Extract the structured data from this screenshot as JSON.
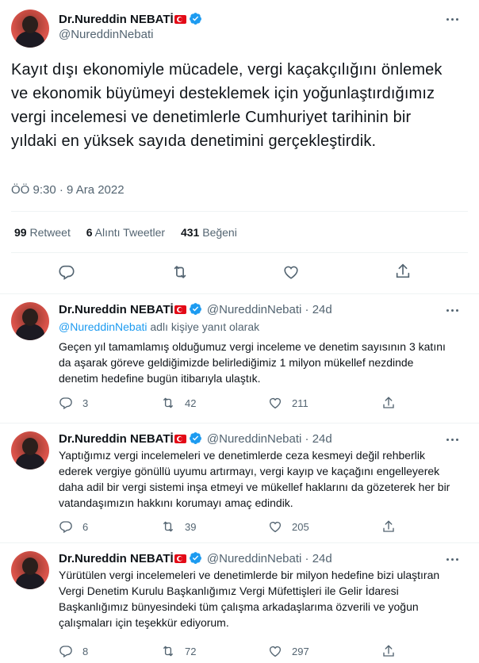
{
  "main": {
    "name": "Dr.Nureddin NEBATİ",
    "handle": "@NureddinNebati",
    "text": "Kayıt dışı ekonomiyle mücadele, vergi kaçakçılığını önlemek ve ekonomik büyümeyi desteklemek için yoğunlaştırdığımız vergi incelemesi ve denetimlerle Cumhuriyet tarihinin bir yıldaki en yüksek sayıda denetimini gerçekleştirdik.",
    "timestamp": "ÖÖ 9:30 · 9 Ara 2022",
    "retweets_count": "99",
    "retweets_label": "Retweet",
    "quotes_count": "6",
    "quotes_label": "Alıntı Tweetler",
    "likes_count": "431",
    "likes_label": "Beğeni"
  },
  "replies": [
    {
      "name": "Dr.Nureddin NEBATİ",
      "handle": "@NureddinNebati · 24d",
      "reply_to_mention": "@NureddinNebati",
      "reply_to_suffix": " adlı kişiye yanıt olarak",
      "text": "Geçen yıl tamamlamış olduğumuz vergi inceleme ve denetim sayısının 3 katını da aşarak göreve geldiğimizde belirlediğimiz 1 milyon mükellef nezdinde denetim hedefine bugün itibarıyla ulaştık.",
      "reply_count": "3",
      "retweet_count": "42",
      "like_count": "211"
    },
    {
      "name": "Dr.Nureddin NEBATİ",
      "handle": "@NureddinNebati · 24d",
      "text": "Yaptığımız vergi incelemeleri ve denetimlerde ceza kesmeyi değil rehberlik ederek vergiye gönüllü uyumu artırmayı, vergi kayıp ve kaçağını engelleyerek daha adil bir vergi sistemi inşa etmeyi ve mükellef haklarını da gözeterek her bir vatandaşımızın hakkını korumayı amaç edindik.",
      "reply_count": "6",
      "retweet_count": "39",
      "like_count": "205"
    },
    {
      "name": "Dr.Nureddin NEBATİ",
      "handle": "@NureddinNebati · 24d",
      "text": "Yürütülen vergi incelemeleri ve denetimlerde bir milyon hedefine bizi ulaştıran Vergi Denetim Kurulu Başkanlığımız Vergi Müfettişleri ile Gelir İdaresi Başkanlığımız bünyesindeki tüm çalışma arkadaşlarıma özverili ve yoğun çalışmaları için teşekkür ediyorum.",
      "reply_count": "8",
      "retweet_count": "72",
      "like_count": "297"
    }
  ],
  "colors": {
    "accent": "#1d9bf0",
    "secondary_text": "#536471",
    "flag": "#e30a17"
  },
  "icons": [
    "more-icon",
    "reply-icon",
    "retweet-icon",
    "like-icon",
    "share-icon",
    "verified-icon",
    "turkish-flag-icon"
  ]
}
